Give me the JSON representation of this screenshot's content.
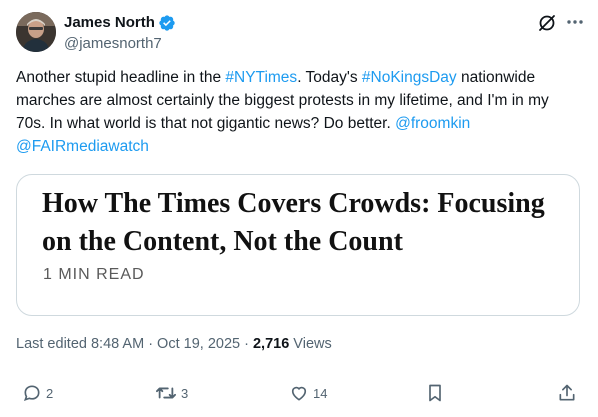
{
  "author": {
    "display_name": "James North",
    "handle": "@jamesnorth7",
    "avatar_icon": "user-avatar",
    "verified_icon": "verified-badge-icon"
  },
  "tweet": {
    "parts": [
      {
        "text": "Another stupid headline in the ",
        "link": false
      },
      {
        "text": "#NYTimes",
        "link": true
      },
      {
        "text": ". Today's ",
        "link": false
      },
      {
        "text": "#NoKingsDay",
        "link": true
      },
      {
        "text": " nationwide marches are almost certainly the biggest protests in my lifetime, and I'm in my 70s. In what world is that not gigantic news? Do better. ",
        "link": false
      },
      {
        "text": "@froomkin",
        "link": true
      },
      {
        "text": " ",
        "link": false
      },
      {
        "text": "@FAIRmediawatch",
        "link": true
      }
    ]
  },
  "card": {
    "headline": "How The Times Covers Crowds: Focusing on the Content, Not the Count",
    "meta": "1 MIN READ"
  },
  "meta": {
    "edited": "Last edited 8:48 AM · Oct 19, 2025 · ",
    "views_count": "2,716",
    "views_label": " Views"
  },
  "actions": {
    "replies": "2",
    "reposts": "3",
    "likes": "14"
  },
  "colors": {
    "link": "#1d9bf0",
    "verified": "#1d9bf0",
    "secondary_text": "#536471"
  }
}
